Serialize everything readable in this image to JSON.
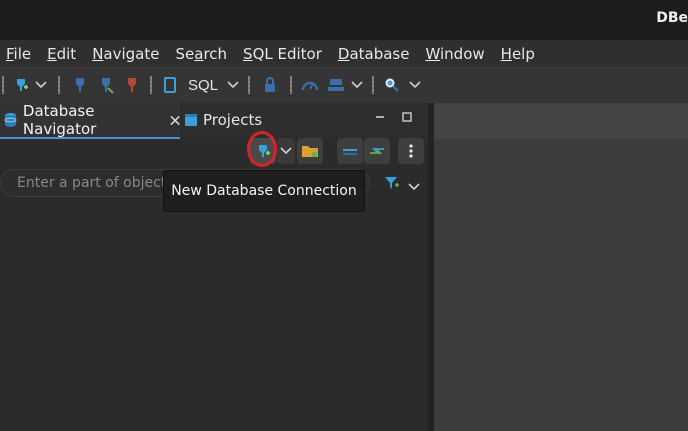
{
  "window": {
    "title": "DBe"
  },
  "menu": {
    "items": [
      {
        "label": "File",
        "mnemonic": "F"
      },
      {
        "label": "Edit",
        "mnemonic": "E"
      },
      {
        "label": "Navigate",
        "mnemonic": "N"
      },
      {
        "label": "Search",
        "mnemonic": "a"
      },
      {
        "label": "SQL Editor",
        "mnemonic": "S"
      },
      {
        "label": "Database",
        "mnemonic": "D"
      },
      {
        "label": "Window",
        "mnemonic": "W"
      },
      {
        "label": "Help",
        "mnemonic": "H"
      }
    ]
  },
  "toolbar": {
    "sql_label": "SQL"
  },
  "navigator": {
    "tabs": [
      {
        "label": "Database Navigator",
        "active": true
      },
      {
        "label": "Projects",
        "active": false
      }
    ],
    "filter_placeholder": "Enter a part of object name here"
  },
  "tooltip": {
    "text": "New Database Connection"
  },
  "colors": {
    "accent": "#4a90d9",
    "highlight_circle": "#d8232a",
    "connection_icon": "#3aa0d8",
    "folder_icon": "#e0a030"
  },
  "icons": [
    "new-connection-icon",
    "disconnect-icon",
    "commit-icon",
    "rollback-icon",
    "sql-editor-icon",
    "lock-icon",
    "gauge-icon",
    "transaction-log-icon",
    "search-icon",
    "close-icon",
    "minimize-icon",
    "maximize-icon",
    "folder-icon",
    "collapse-icon",
    "link-icon",
    "more-icon",
    "filter-icon"
  ]
}
